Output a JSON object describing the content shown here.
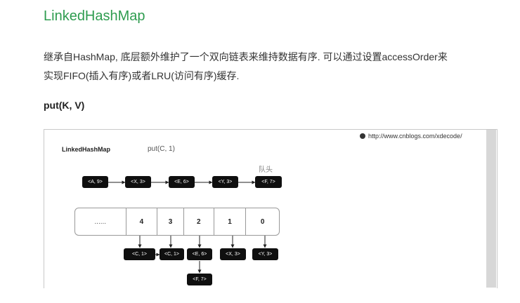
{
  "article": {
    "title": "LinkedHashMap",
    "paragraph_line1": "继承自HashMap, 底层额外维护了一个双向链表来维持数据有序. 可以通过设置accessOrder来",
    "paragraph_line2": "实现FIFO(插入有序)或者LRU(访问有序)缓存.",
    "subtitle": "put(K, V)"
  },
  "figure": {
    "watermark": "http://www.cnblogs.com/xdecode/",
    "map_label": "LinkedHashMap",
    "operation": "put(C, 1)",
    "head_label": "队头",
    "list_nodes": [
      "<A, 9>",
      "<X, 3>",
      "<E, 6>",
      "<Y, 3>",
      "<F, 7>"
    ],
    "array_cells": [
      "......",
      "4",
      "3",
      "2",
      "1",
      "0"
    ],
    "bucket_nodes": [
      "<C, 1>",
      "<C, 1>",
      "<E, 6>",
      "<X, 3>",
      "<Y, 3>"
    ],
    "chain_node": "<F, 7>"
  }
}
